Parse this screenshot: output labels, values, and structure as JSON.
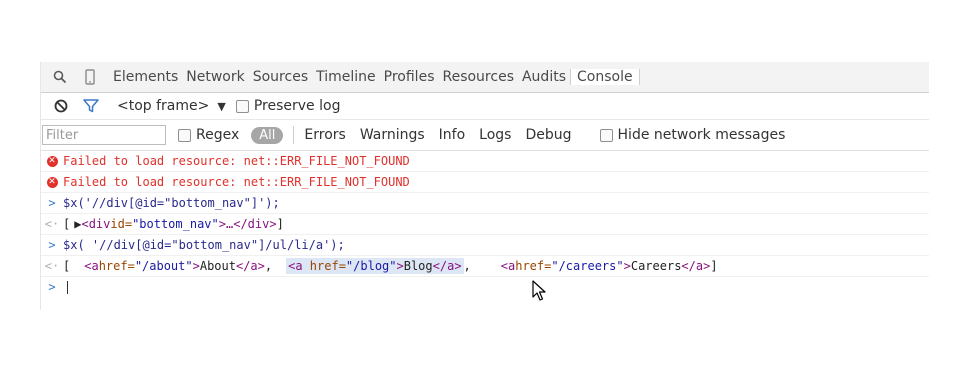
{
  "tabs": {
    "items": [
      "Elements",
      "Network",
      "Sources",
      "Timeline",
      "Profiles",
      "Resources",
      "Audits",
      "Console"
    ],
    "active": "Console"
  },
  "toolbar": {
    "frame_label": "<top frame>",
    "preserve_log": "Preserve log"
  },
  "filterbar": {
    "placeholder": "Filter",
    "regex": "Regex",
    "levels": [
      "All",
      "Errors",
      "Warnings",
      "Info",
      "Logs",
      "Debug"
    ],
    "hide_network": "Hide network messages"
  },
  "console": {
    "error1": "Failed to load resource: net::ERR_FILE_NOT_FOUND",
    "error2": "Failed to load resource: net::ERR_FILE_NOT_FOUND",
    "cmd1": "$x('//div[@id=\"bottom_nav\"]');",
    "res1": {
      "open": "[",
      "tri": "▶",
      "tag_open": "<div ",
      "attr": "id=",
      "val": "\"bottom_nav\"",
      "rest": ">…</div>",
      "close": "]"
    },
    "cmd2": "$x( '//div[@id=\"bottom_nav\"]/ul/li/a');",
    "res2": {
      "open": "[",
      "a1_tag": "<a ",
      "a1_attr": "href=",
      "a1_val": "\"/about\"",
      "a1_gt": ">",
      "a1_text": "About",
      "a1_close": "</a>",
      "comma1": ",",
      "a2_tag": "<a ",
      "a2_attr": "href=",
      "a2_val": "\"/blog\"",
      "a2_gt": ">",
      "a2_text": "Blog",
      "a2_close": "</a>",
      "comma2": ",",
      "a3_tag": "<a ",
      "a3_attr": "href=",
      "a3_val": "\"/careers\"",
      "a3_gt": ">",
      "a3_text": "Careers",
      "a3_close": "</a>",
      "close": "]"
    }
  },
  "colors": {
    "error": "#e0312a",
    "prompt": "#3a79c8",
    "active_filter": "#a6a6a6"
  }
}
